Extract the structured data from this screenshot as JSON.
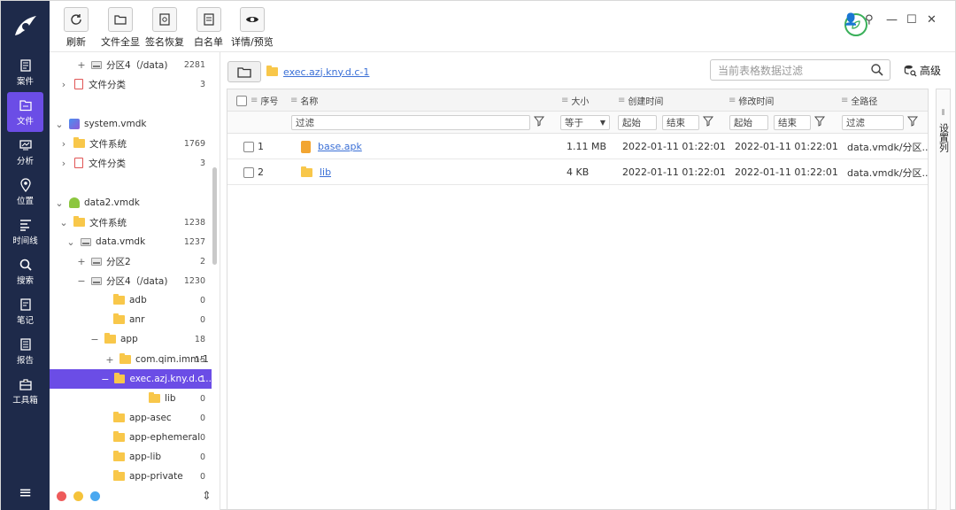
{
  "nav": {
    "items": [
      {
        "label": "案件",
        "icon": "case-icon"
      },
      {
        "label": "文件",
        "icon": "file-icon",
        "active": true
      },
      {
        "label": "分析",
        "icon": "analysis-icon"
      },
      {
        "label": "位置",
        "icon": "location-icon"
      },
      {
        "label": "时间线",
        "icon": "timeline-icon"
      },
      {
        "label": "搜索",
        "icon": "search-icon"
      },
      {
        "label": "笔记",
        "icon": "note-icon"
      },
      {
        "label": "报告",
        "icon": "report-icon"
      },
      {
        "label": "工具箱",
        "icon": "toolbox-icon"
      }
    ]
  },
  "toolbar": {
    "refresh": "刷新",
    "show_all": "文件全显",
    "sig_restore": "签名恢复",
    "whitelist": "白名单",
    "preview": "详情/预览"
  },
  "tree": {
    "rows": [
      {
        "exp": "+",
        "icon": "disk",
        "label": "分区4（/data)",
        "count": "2281"
      },
      {
        "exp": "›",
        "icon": "doc",
        "label": "文件分类",
        "count": "3"
      },
      {
        "exp": "⌄",
        "icon": "vm",
        "label": "system.vmdk",
        "count": ""
      },
      {
        "exp": "›",
        "icon": "folder",
        "label": "文件系统",
        "count": "1769"
      },
      {
        "exp": "›",
        "icon": "doc",
        "label": "文件分类",
        "count": "3"
      },
      {
        "exp": "⌄",
        "icon": "android",
        "label": "data2.vmdk",
        "count": ""
      },
      {
        "exp": "⌄",
        "icon": "folder",
        "label": "文件系统",
        "count": "1238"
      },
      {
        "exp": "⌄",
        "icon": "disk",
        "label": "data.vmdk",
        "count": "1237"
      },
      {
        "exp": "+",
        "icon": "disk",
        "label": "分区2",
        "count": "2"
      },
      {
        "exp": "−",
        "icon": "disk",
        "label": "分区4（/data)",
        "count": "1230"
      },
      {
        "exp": "",
        "icon": "folder",
        "label": "adb",
        "count": "0"
      },
      {
        "exp": "",
        "icon": "folder",
        "label": "anr",
        "count": "0"
      },
      {
        "exp": "−",
        "icon": "folder",
        "label": "app",
        "count": "18"
      },
      {
        "exp": "+",
        "icon": "folder",
        "label": "com.qim.imm-1",
        "count": "15"
      },
      {
        "exp": "−",
        "icon": "folder",
        "label": "exec.azj.kny.d.c...",
        "count": "1",
        "selected": true
      },
      {
        "exp": "",
        "icon": "folder",
        "label": "lib",
        "count": "0"
      },
      {
        "exp": "",
        "icon": "folder",
        "label": "app-asec",
        "count": "0"
      },
      {
        "exp": "",
        "icon": "folder",
        "label": "app-ephemeral",
        "count": "0"
      },
      {
        "exp": "",
        "icon": "folder",
        "label": "app-lib",
        "count": "0"
      },
      {
        "exp": "",
        "icon": "folder",
        "label": "app-private",
        "count": "0"
      }
    ]
  },
  "path": {
    "current": "exec.azj.kny.d.c-1"
  },
  "search": {
    "placeholder": "当前表格数据过滤"
  },
  "advanced": "高级",
  "table": {
    "headers": {
      "index": "序号",
      "name": "名称",
      "size": "大小",
      "created": "创建时间",
      "modified": "修改时间",
      "fullpath": "全路径"
    },
    "filters": {
      "name": "过滤",
      "size_op": "等于",
      "created_start": "起始",
      "created_end": "结束",
      "modified_start": "起始",
      "modified_end": "结束",
      "fullpath": "过滤"
    },
    "rows": [
      {
        "index": "1",
        "name": "base.apk",
        "type": "apk",
        "size": "1.11 MB",
        "created": "2022-01-11 01:22:01",
        "modified": "2022-01-11 01:22:01",
        "fullpath": "data.vmdk/分区..."
      },
      {
        "index": "2",
        "name": "lib",
        "type": "folder",
        "size": "4 KB",
        "created": "2022-01-11 01:22:01",
        "modified": "2022-01-11 01:22:01",
        "fullpath": "data.vmdk/分区..."
      }
    ]
  },
  "side_tab": "设置列",
  "colors": {
    "nav_bg": "#1e2a4a",
    "accent": "#6b4de6",
    "link": "#3a6fd6",
    "folder": "#f8c74a"
  }
}
